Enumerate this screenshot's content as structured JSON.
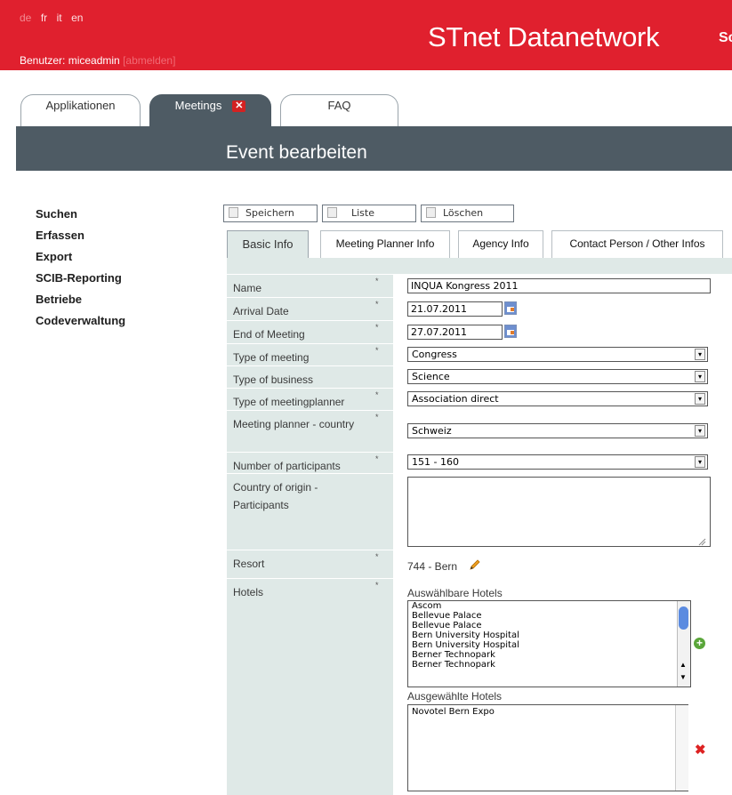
{
  "header": {
    "languages": [
      "de",
      "fr",
      "it",
      "en"
    ],
    "user_prefix": "Benutzer: miceadmin",
    "logout_label": "[abmelden]",
    "brand": "STnet Datanetwork",
    "brand_cut": "Sc"
  },
  "app_tabs": [
    {
      "label": "Applikationen"
    },
    {
      "label": "Meetings",
      "close": "✕"
    },
    {
      "label": "FAQ"
    }
  ],
  "page_title": "Event bearbeiten",
  "sidebar": [
    "Suchen",
    "Erfassen",
    "Export",
    "SCIB-Reporting",
    "Betriebe",
    "Codeverwaltung"
  ],
  "toolbar": {
    "save": "Speichern",
    "list": "Liste",
    "delete": "Löschen"
  },
  "form_tabs": [
    "Basic Info",
    "Meeting Planner Info",
    "Agency Info",
    "Contact Person / Other Infos"
  ],
  "fields": {
    "name": {
      "label": "Name",
      "required": "*",
      "value": "INQUA Kongress 2011"
    },
    "arrival": {
      "label": "Arrival Date",
      "required": "*",
      "value": "21.07.2011"
    },
    "end": {
      "label": "End of Meeting",
      "required": "*",
      "value": "27.07.2011"
    },
    "type_meeting": {
      "label": "Type of meeting",
      "required": "*",
      "value": "Congress"
    },
    "type_business": {
      "label": "Type of business",
      "value": "Science"
    },
    "type_planner": {
      "label": "Type of meetingplanner",
      "required": "*",
      "value": "Association direct"
    },
    "planner_country": {
      "label": "Meeting planner - country",
      "required": "*",
      "value": "Schweiz"
    },
    "participants": {
      "label": "Number of participants",
      "required": "*",
      "value": "151 - 160"
    },
    "origin": {
      "label": "Country of origin - Participants",
      "value": ""
    },
    "resort": {
      "label": "Resort",
      "required": "*",
      "value": "744 - Bern"
    },
    "hotels": {
      "label": "Hotels",
      "required": "*"
    }
  },
  "hotels": {
    "available_label": "Auswählbare Hotels",
    "available": [
      "Ascom",
      "Bellevue Palace",
      "Bellevue Palace",
      "Bern University Hospital",
      "Bern University Hospital",
      "Berner Technopark",
      "Berner Technopark"
    ],
    "selected_label": "Ausgewählte Hotels",
    "selected": [
      "Novotel Bern Expo"
    ]
  },
  "colors": {
    "brand_red": "#e0202e",
    "titlebar": "#4e5b64",
    "form_bg": "#dfe9e7"
  }
}
